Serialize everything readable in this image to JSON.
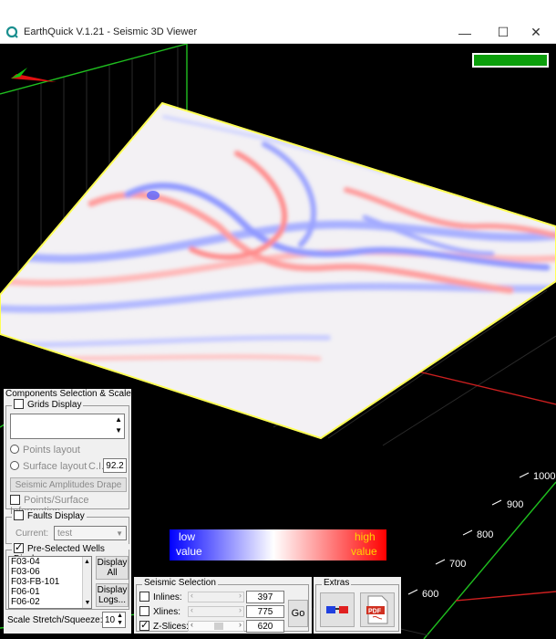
{
  "window": {
    "title": "EarthQuick V.1.21 - Seismic 3D Viewer"
  },
  "axis": {
    "depth_ticks": [
      "1000",
      "900",
      "800",
      "700",
      "600"
    ]
  },
  "components": {
    "title": "Components Selection & Scale",
    "grids_display": "Grids Display",
    "points_layout": "Points layout",
    "surface_layout": "Surface layout",
    "ci_label": "C.I.:",
    "ci_value": "92.2",
    "amplitudes_drape": "Seismic Amplitudes Drape",
    "points_surface_info": "Points/Surface Information",
    "faults_display": "Faults Display",
    "current_label": "Current:",
    "current_value": "test",
    "wells_display": "Pre-Selected Wells Display",
    "wells": [
      "F03-04",
      "F03-06",
      "F03-FB-101",
      "F06-01",
      "F06-02"
    ],
    "display_all": "Display All",
    "display_logs": "Display Logs...",
    "scale_label": "Scale Stretch/Squeeze:",
    "scale_value": "10"
  },
  "legend": {
    "low1": "low",
    "low2": "value",
    "high1": "high",
    "high2": "value"
  },
  "seismic": {
    "title": "Seismic Selection",
    "inlines_label": "Inlines:",
    "inlines_value": "397",
    "xlines_label": "Xlines:",
    "xlines_value": "775",
    "zslices_label": "Z-Slices:",
    "zslices_value": "620",
    "go": "Go"
  },
  "extras": {
    "title": "Extras"
  },
  "colors": {
    "status_green": "#0b9e0b",
    "frame_yellow": "#ffff55"
  }
}
